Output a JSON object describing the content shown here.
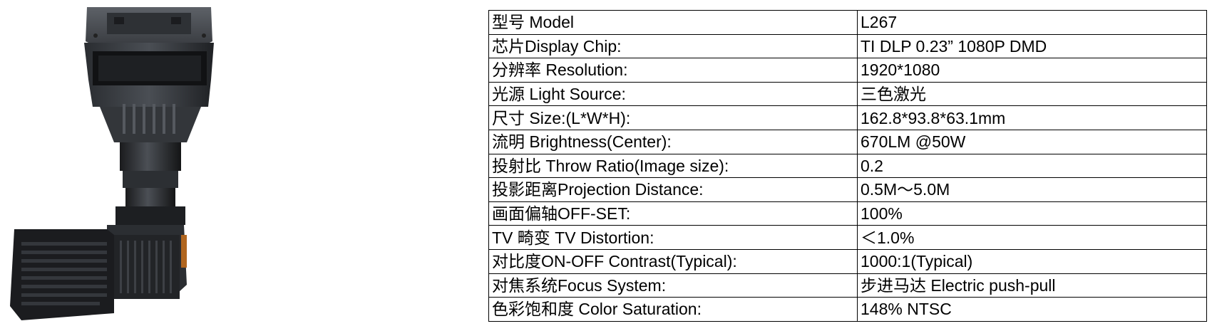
{
  "product": {
    "image": "projector-optical-engine-photo"
  },
  "spec_table": {
    "rows": [
      {
        "label": "型号 Model",
        "value": "L267"
      },
      {
        "label": "芯片Display Chip:",
        "value": "TI DLP 0.23”  1080P DMD"
      },
      {
        "label": "分辨率  Resolution:",
        "value": "1920*1080"
      },
      {
        "label": "光源 Light Source:",
        "value": "三色激光"
      },
      {
        "label": "尺寸 Size:(L*W*H):",
        "value": "162.8*93.8*63.1mm"
      },
      {
        "label": "流明 Brightness(Center):",
        "value": "670LM @50W"
      },
      {
        "label": "投射比 Throw Ratio(Image size):",
        "value": "0.2"
      },
      {
        "label": "投影距离Projection Distance:",
        "value": "0.5M～5.0M"
      },
      {
        "label": "画面偏轴OFF-SET:",
        "value": "100%"
      },
      {
        "label": "TV 畸变 TV Distortion:",
        "value": "＜1.0%"
      },
      {
        "label": "对比度ON-OFF Contrast(Typical):",
        "value": "1000:1(Typical)"
      },
      {
        "label": "对焦系统Focus System:",
        "value": "步进马达 Electric push-pull"
      },
      {
        "label": "色彩饱和度 Color Saturation:",
        "value": "148% NTSC"
      }
    ]
  }
}
